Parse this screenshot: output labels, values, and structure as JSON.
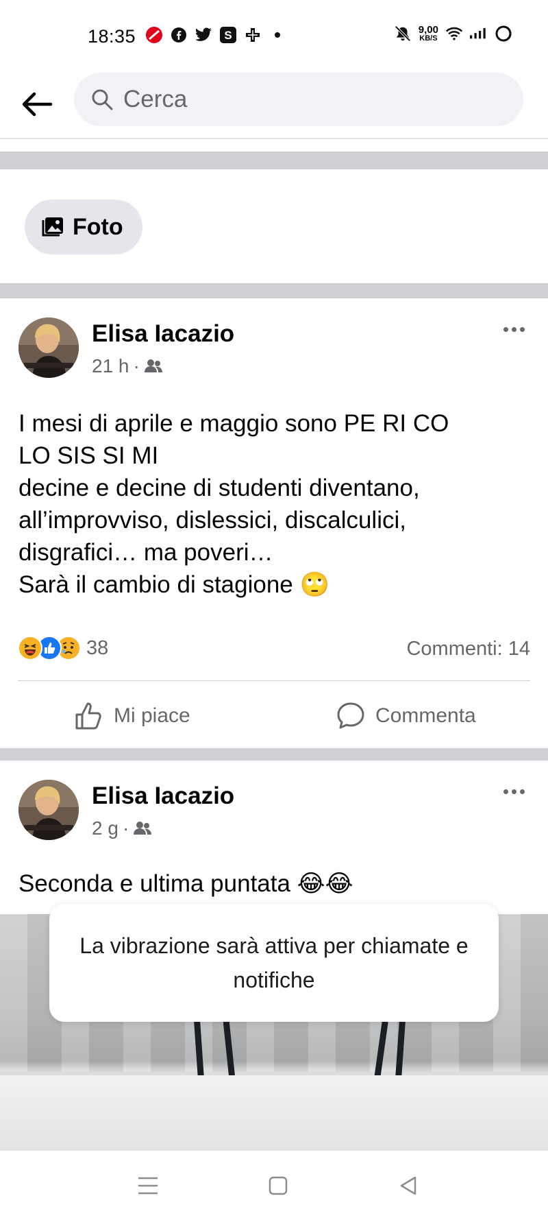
{
  "status_bar": {
    "time": "18:35",
    "net_speed_value": "9,00",
    "net_speed_unit": "KB/S",
    "left_icons": [
      "unicredit-icon",
      "facebook-icon",
      "twitter-icon",
      "s-app-icon",
      "pharmacy-cross-icon",
      "dot-icon"
    ],
    "right_icons": [
      "mute-bell-icon",
      "wifi-icon",
      "signal-icon",
      "battery-icon"
    ]
  },
  "search": {
    "placeholder": "Cerca"
  },
  "filter_chip": {
    "label": "Foto",
    "icon": "photo-icon"
  },
  "posts": [
    {
      "author": "Elisa Iacazio",
      "time": "21 h",
      "audience_icon": "friends-icon",
      "text_lines": [
        "I mesi di aprile e maggio sono PE RI CO",
        "LO SIS SI MI",
        "decine e decine di studenti diventano,",
        "all’improvviso, dislessici, discalculici,",
        "disgrafici… ma poveri…",
        "Sarà il cambio di stagione 🙄"
      ],
      "reactions": [
        "haha-icon",
        "like-icon",
        "sad-icon"
      ],
      "reaction_count": "38",
      "comments": "Commenti: 14",
      "like_label": "Mi piace",
      "comment_label": "Commenta"
    },
    {
      "author": "Elisa Iacazio",
      "time": "2 g",
      "audience_icon": "friends-icon",
      "text": "Seconda e ultima puntata 😂😂"
    }
  ],
  "toast": {
    "text": "La vibrazione sarà attiva per chiamate e notifiche"
  },
  "colors": {
    "secondary_text": "#65676b",
    "search_bg": "#f0f2f5",
    "chip_bg": "#e4e6eb",
    "divider": "#ced0d4",
    "like_blue": "#1877f2"
  }
}
